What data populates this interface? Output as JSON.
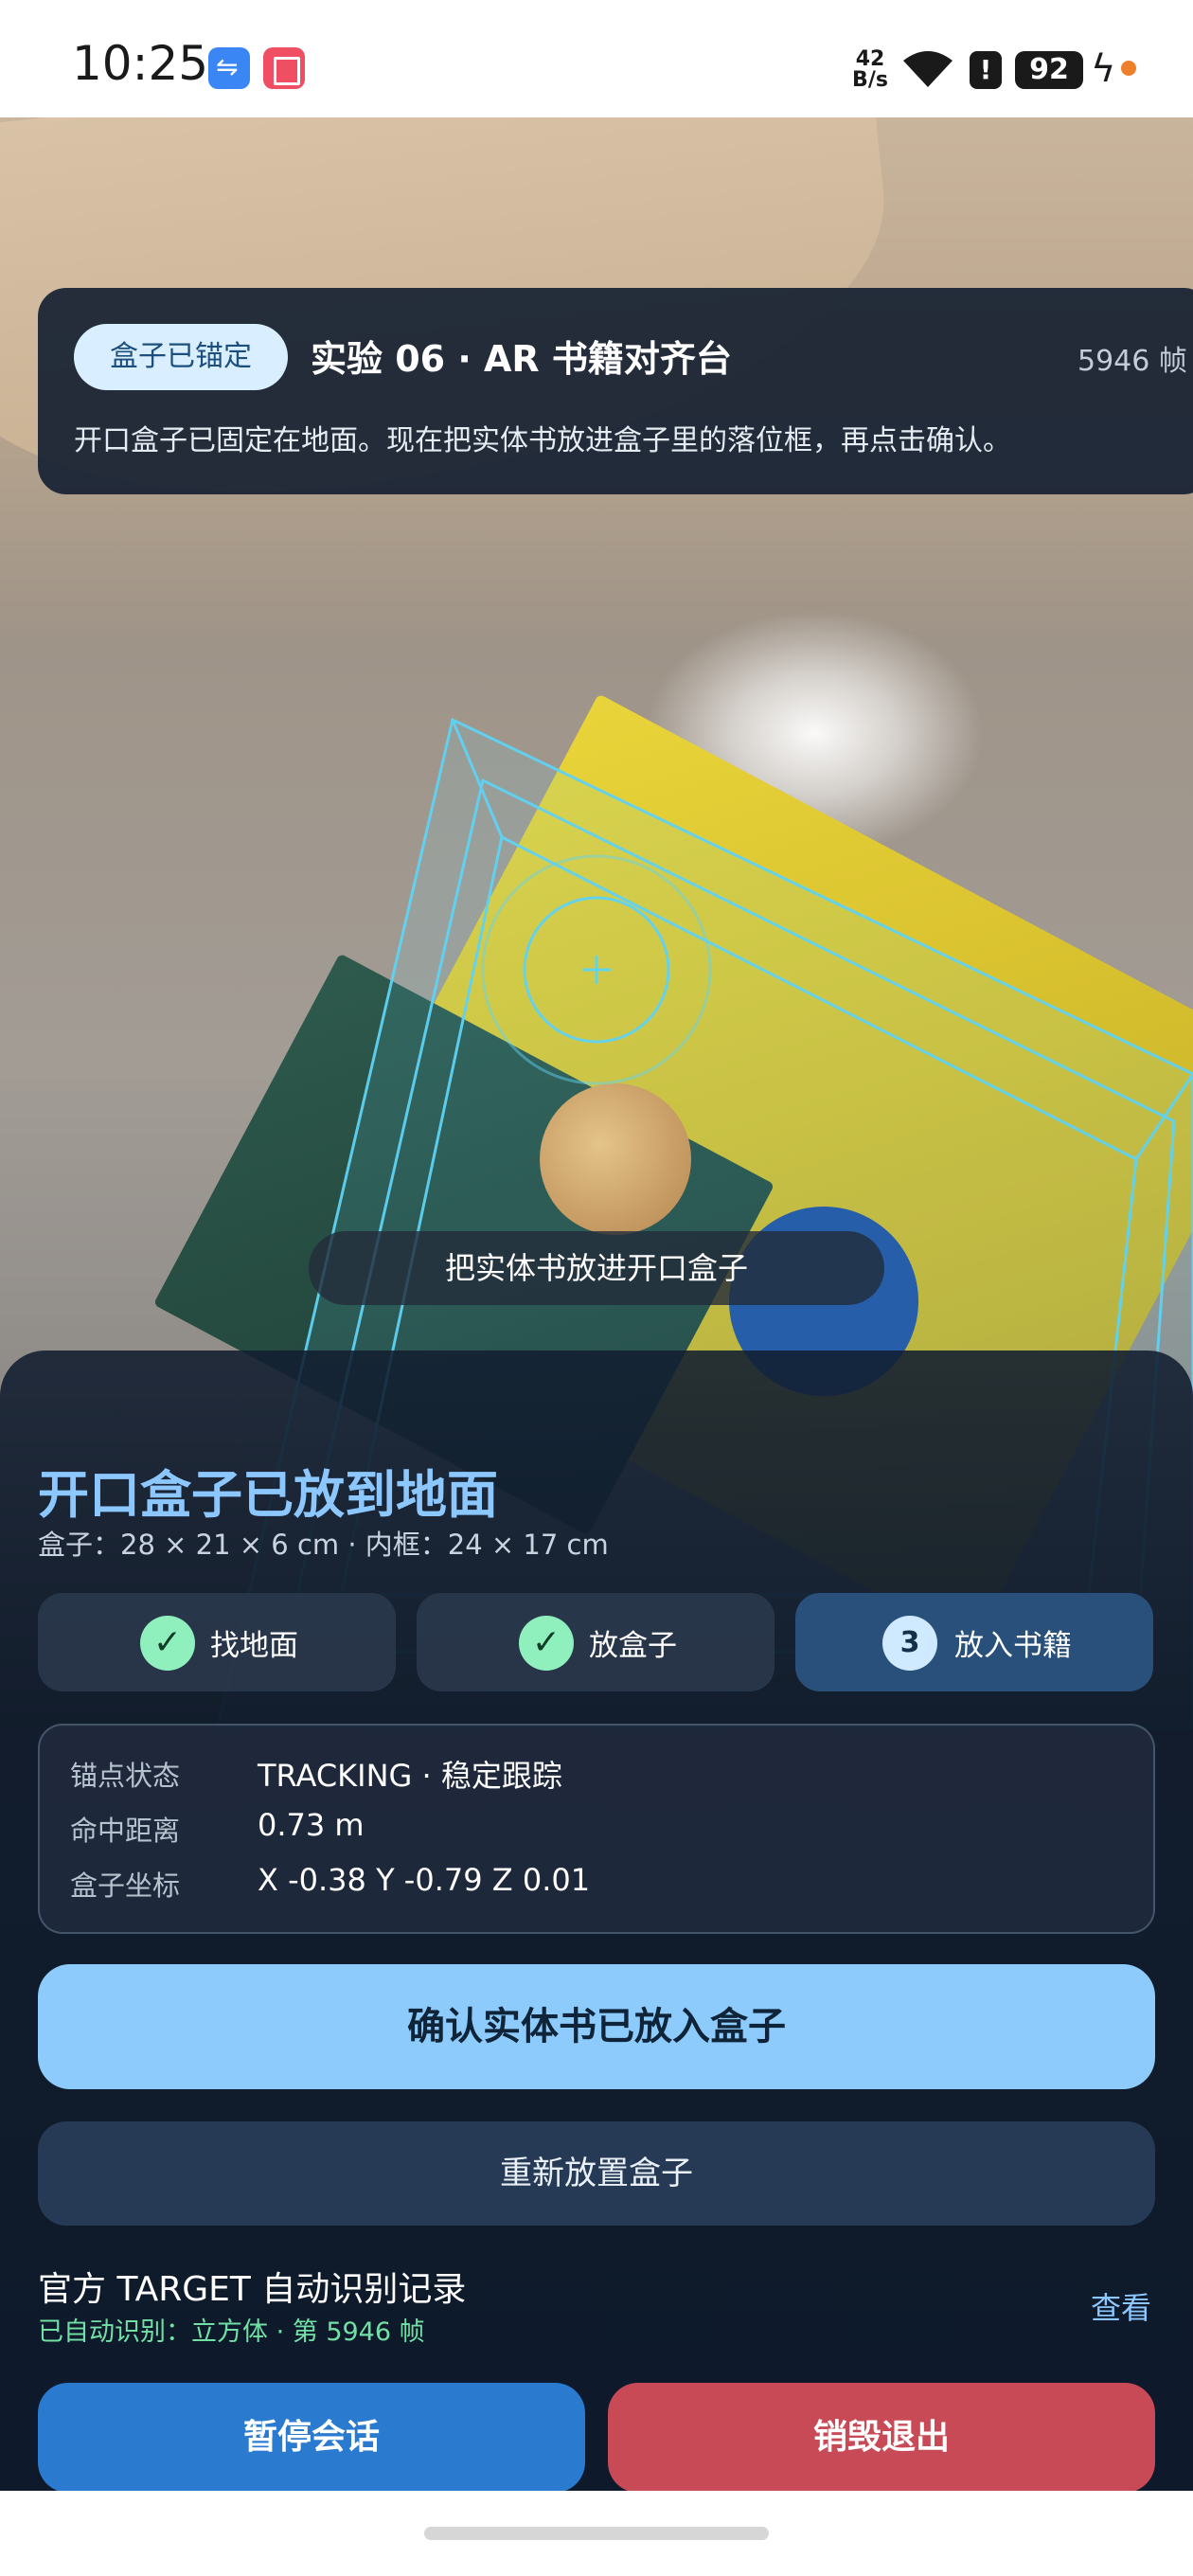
{
  "status_bar": {
    "time": "10:25",
    "net_speed_value": "42",
    "net_speed_unit": "B/s",
    "battery": "92",
    "alert_glyph": "!",
    "icons": [
      "usb-debug-icon",
      "book-app-icon",
      "wifi-icon",
      "alert-icon",
      "battery-icon",
      "charging-bolt-icon"
    ]
  },
  "top_card": {
    "badge": "盒子已锚定",
    "title": "实验 06 · AR 书籍对齐台",
    "frame_count": "5946 帧",
    "description": "开口盒子已固定在地面。现在把实体书放进盒子里的落位框，再点击确认。"
  },
  "hint": "把实体书放进开口盒子",
  "sheet": {
    "title": "开口盒子已放到地面",
    "subtitle": "盒子：28 × 21 × 6 cm · 内框：24 × 17 cm",
    "steps": [
      {
        "label": "找地面",
        "marker": "✓",
        "state": "done"
      },
      {
        "label": "放盒子",
        "marker": "✓",
        "state": "done"
      },
      {
        "label": "放入书籍",
        "marker": "3",
        "state": "current"
      }
    ],
    "info": [
      {
        "key": "锚点状态",
        "value": "TRACKING · 稳定跟踪"
      },
      {
        "key": "命中距离",
        "value": "0.73 m"
      },
      {
        "key": "盒子坐标",
        "value": "X -0.38  Y -0.79  Z 0.01"
      }
    ],
    "confirm_label": "确认实体书已放入盒子",
    "reposition_label": "重新放置盒子",
    "record_title": "官方 TARGET 自动识别记录",
    "record_sub": "已自动识别：立方体 · 第 5946 帧",
    "record_link": "查看",
    "pause_label": "暂停会话",
    "exit_label": "销毁退出"
  },
  "colors": {
    "accent": "#8ccbfb",
    "success": "#8ff0be",
    "danger": "#c74a56",
    "primary_dark": "#2a7ad0",
    "ar_wireframe": "#5fd3f5"
  }
}
